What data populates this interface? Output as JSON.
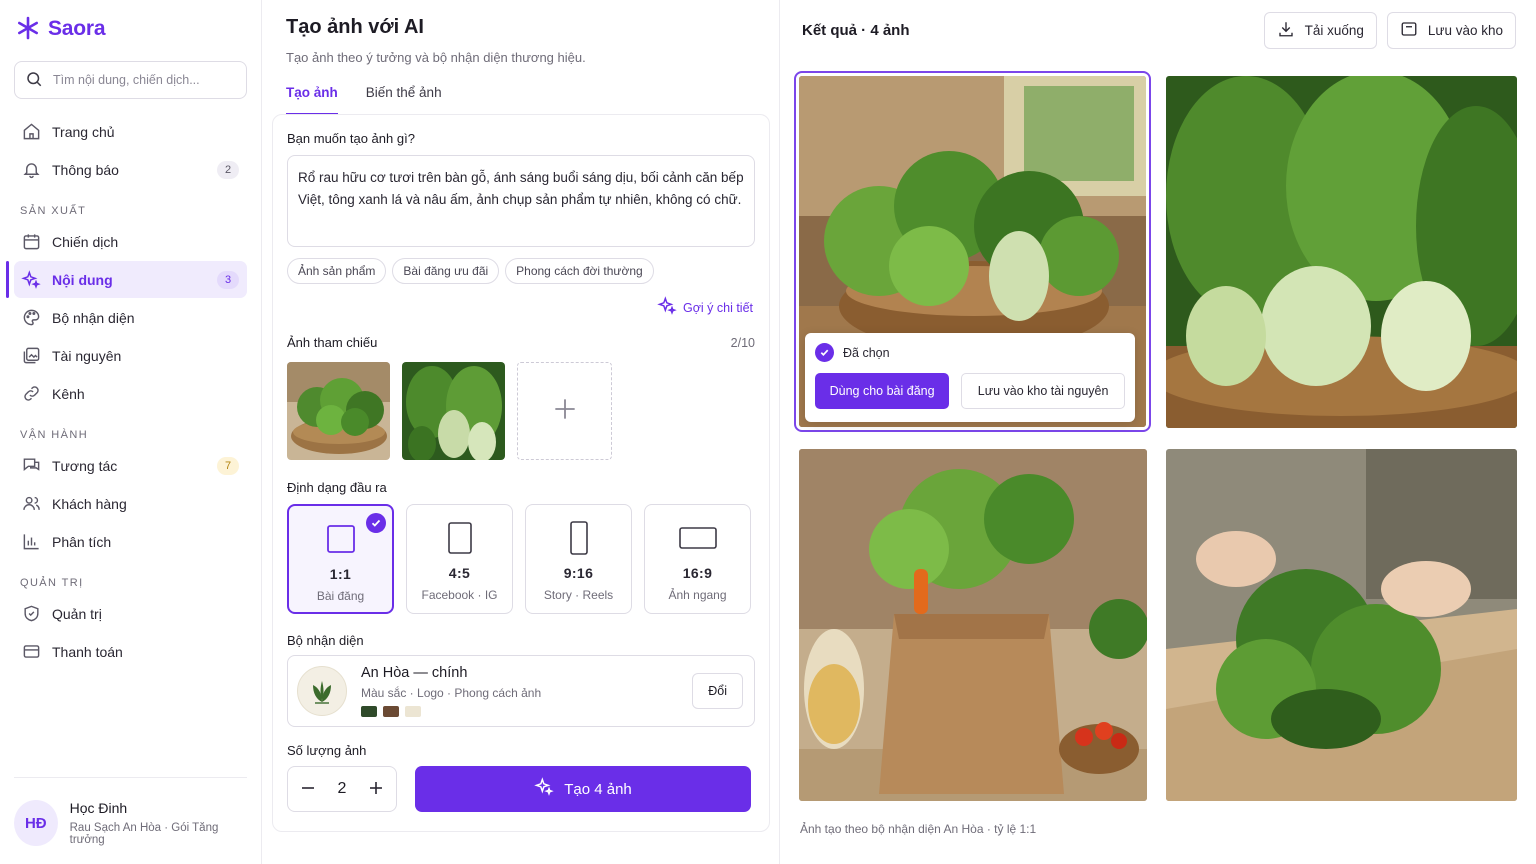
{
  "brand": {
    "name": "Saora",
    "color": "#6a2ee8"
  },
  "search": {
    "placeholder": "Tìm nội dung, chiến dịch..."
  },
  "nav": {
    "top": [
      {
        "label": "Trang chủ",
        "icon": "home-icon"
      },
      {
        "label": "Thông báo",
        "icon": "bell-icon",
        "count": "2"
      }
    ],
    "section_production": "SẢN XUẤT",
    "production": [
      {
        "label": "Chiến dịch",
        "icon": "calendar-icon"
      },
      {
        "label": "Nội dung",
        "icon": "sparkle-icon",
        "count": "3",
        "active": true
      },
      {
        "label": "Bộ nhận diện",
        "icon": "palette-icon"
      },
      {
        "label": "Tài nguyên",
        "icon": "image-library-icon"
      },
      {
        "label": "Kênh",
        "icon": "link-icon"
      }
    ],
    "section_operations": "VẬN HÀNH",
    "operations": [
      {
        "label": "Tương tác",
        "icon": "chat-icon",
        "count": "7"
      },
      {
        "label": "Khách hàng",
        "icon": "users-icon"
      },
      {
        "label": "Phân tích",
        "icon": "bar-chart-icon"
      }
    ],
    "section_admin": "QUẢN TRỊ",
    "admin": [
      {
        "label": "Quản trị",
        "icon": "shield-icon"
      },
      {
        "label": "Thanh toán",
        "icon": "credit-card-icon"
      }
    ]
  },
  "user": {
    "initials": "HĐ",
    "name": "Học Đinh",
    "subtitle": "Rau Sạch An Hòa · Gói Tăng trưởng"
  },
  "page": {
    "title": "Tạo ảnh với AI",
    "subtitle": "Tạo ảnh theo ý tưởng và bộ nhận diện thương hiệu.",
    "tabs": [
      "Tạo ảnh",
      "Biến thể ảnh"
    ],
    "active_tab": 0
  },
  "form": {
    "question": "Bạn muốn tạo ảnh gì?",
    "prompt_value": "Rổ rau hữu cơ tươi trên bàn gỗ, ánh sáng buổi sáng dịu, bối cảnh căn bếp Việt, tông xanh lá và nâu ấm, ảnh chụp sản phẩm tự nhiên, không có chữ.",
    "chips": [
      "Ảnh sản phẩm",
      "Bài đăng ưu đãi",
      "Phong cách đời thường"
    ],
    "suggest_label": "Gợi ý chi tiết",
    "reference_label": "Ảnh tham chiếu",
    "reference_count": "2/10",
    "format_label": "Định dạng đầu ra",
    "formats": [
      {
        "ratio": "1:1",
        "sub": "Bài đăng",
        "selected": true
      },
      {
        "ratio": "4:5",
        "sub": "Facebook · IG"
      },
      {
        "ratio": "9:16",
        "sub": "Story · Reels"
      },
      {
        "ratio": "16:9",
        "sub": "Ảnh ngang"
      }
    ],
    "brand_kit_label": "Bộ nhận diện",
    "brand_kit": {
      "name": "An Hòa — chính",
      "meta": "Màu sắc  ·  Logo  ·  Phong cách ảnh",
      "swatches": [
        "#2f4a2a",
        "#6b4a34",
        "#ece5d3"
      ],
      "change_label": "Đổi"
    },
    "quantity_label": "Số lượng ảnh",
    "quantity_value": "2",
    "generate_label": "Tạo 4 ảnh"
  },
  "results": {
    "title": "Kết quả · 4 ảnh",
    "download_label": "Tải xuống",
    "save_label": "Lưu vào kho",
    "selected_label": "Đã chọn",
    "use_label": "Dùng cho bài đăng",
    "save_asset_label": "Lưu vào kho tài nguyên",
    "footer": "Ảnh tạo theo bộ nhận diện An Hòa  ·  tỷ lệ 1:1"
  }
}
